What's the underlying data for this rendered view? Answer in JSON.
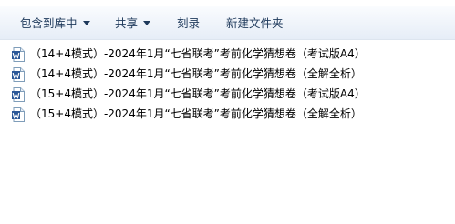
{
  "toolbar": {
    "include_in_library": "包含到库中",
    "share": "共享",
    "burn": "刻录",
    "new_folder": "新建文件夹"
  },
  "files": [
    {
      "name": "（14+4模式）-2024年1月“七省联考”考前化学猜想卷（考试版A4）",
      "icon": "word-document-icon"
    },
    {
      "name": "（14+4模式）-2024年1月“七省联考”考前化学猜想卷（全解全析）",
      "icon": "word-document-icon"
    },
    {
      "name": "（15+4模式）-2024年1月“七省联考”考前化学猜想卷（考试版A4）",
      "icon": "word-document-icon"
    },
    {
      "name": "（15+4模式）-2024年1月“七省联考”考前化学猜想卷（全解全析）",
      "icon": "word-document-icon"
    }
  ],
  "colors": {
    "toolbar_text": "#1e395b",
    "word_icon_blue": "#2b5797"
  }
}
